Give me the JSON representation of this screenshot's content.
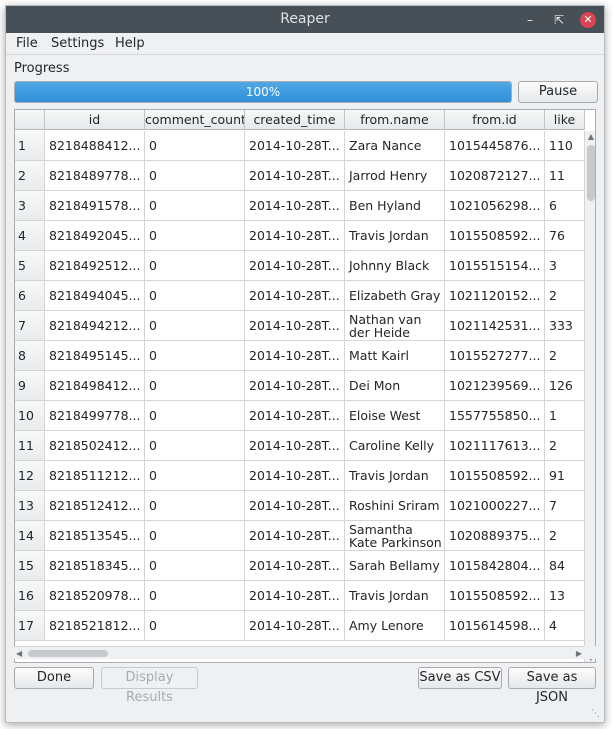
{
  "window": {
    "title": "Reaper",
    "minimize_icon": "minimize-icon",
    "maximize_icon": "restore-icon",
    "close_icon": "close-icon"
  },
  "menubar": {
    "items": [
      "File",
      "Settings",
      "Help"
    ]
  },
  "progress": {
    "label": "Progress",
    "value": 100,
    "text": "100%",
    "color": "#3daee9"
  },
  "buttons": {
    "pause": "Pause",
    "done": "Done",
    "display_results": "Display Results",
    "save_csv": "Save as CSV",
    "save_json": "Save as JSON"
  },
  "table": {
    "columns": [
      "id",
      "comment_count",
      "created_time",
      "from.name",
      "from.id",
      "like"
    ],
    "rows": [
      [
        "1",
        "8218488412...",
        "0",
        "2014-10-28T...",
        "Zara Nance",
        "1015445876...",
        "110"
      ],
      [
        "2",
        "8218489778...",
        "0",
        "2014-10-28T...",
        "Jarrod Henry",
        "1020872127...",
        "11"
      ],
      [
        "3",
        "8218491578...",
        "0",
        "2014-10-28T...",
        "Ben Hyland",
        "1021056298...",
        "6"
      ],
      [
        "4",
        "8218492045...",
        "0",
        "2014-10-28T...",
        "Travis Jordan",
        "1015508592...",
        "76"
      ],
      [
        "5",
        "8218492512...",
        "0",
        "2014-10-28T...",
        "Johnny Black",
        "1015515154...",
        "3"
      ],
      [
        "6",
        "8218494045...",
        "0",
        "2014-10-28T...",
        "Elizabeth Gray",
        "1021120152...",
        "2"
      ],
      [
        "7",
        "8218494212...",
        "0",
        "2014-10-28T...",
        "Nathan van der Heide",
        "1021142531...",
        "333"
      ],
      [
        "8",
        "8218495145...",
        "0",
        "2014-10-28T...",
        "Matt Kairl",
        "1015527277...",
        "2"
      ],
      [
        "9",
        "8218498412...",
        "0",
        "2014-10-28T...",
        "Dei Mon",
        "1021239569...",
        "126"
      ],
      [
        "10",
        "8218499778...",
        "0",
        "2014-10-28T...",
        "Eloise West",
        "1557755850...",
        "1"
      ],
      [
        "11",
        "8218502412...",
        "0",
        "2014-10-28T...",
        "Caroline Kelly",
        "1021117613...",
        "2"
      ],
      [
        "12",
        "8218511212...",
        "0",
        "2014-10-28T...",
        "Travis Jordan",
        "1015508592...",
        "91"
      ],
      [
        "13",
        "8218512412...",
        "0",
        "2014-10-28T...",
        "Roshini Sriram",
        "1021000227...",
        "7"
      ],
      [
        "14",
        "8218513545...",
        "0",
        "2014-10-28T...",
        "Samantha Kate Parkinson",
        "1020889375...",
        "2"
      ],
      [
        "15",
        "8218518345...",
        "0",
        "2014-10-28T...",
        "Sarah Bellamy",
        "1015842804...",
        "84"
      ],
      [
        "16",
        "8218520978...",
        "0",
        "2014-10-28T...",
        "Travis Jordan",
        "1015508592...",
        "13"
      ],
      [
        "17",
        "8218521812...",
        "0",
        "2014-10-28T...",
        "Amy Lenore",
        "1015614598...",
        "4"
      ]
    ]
  }
}
